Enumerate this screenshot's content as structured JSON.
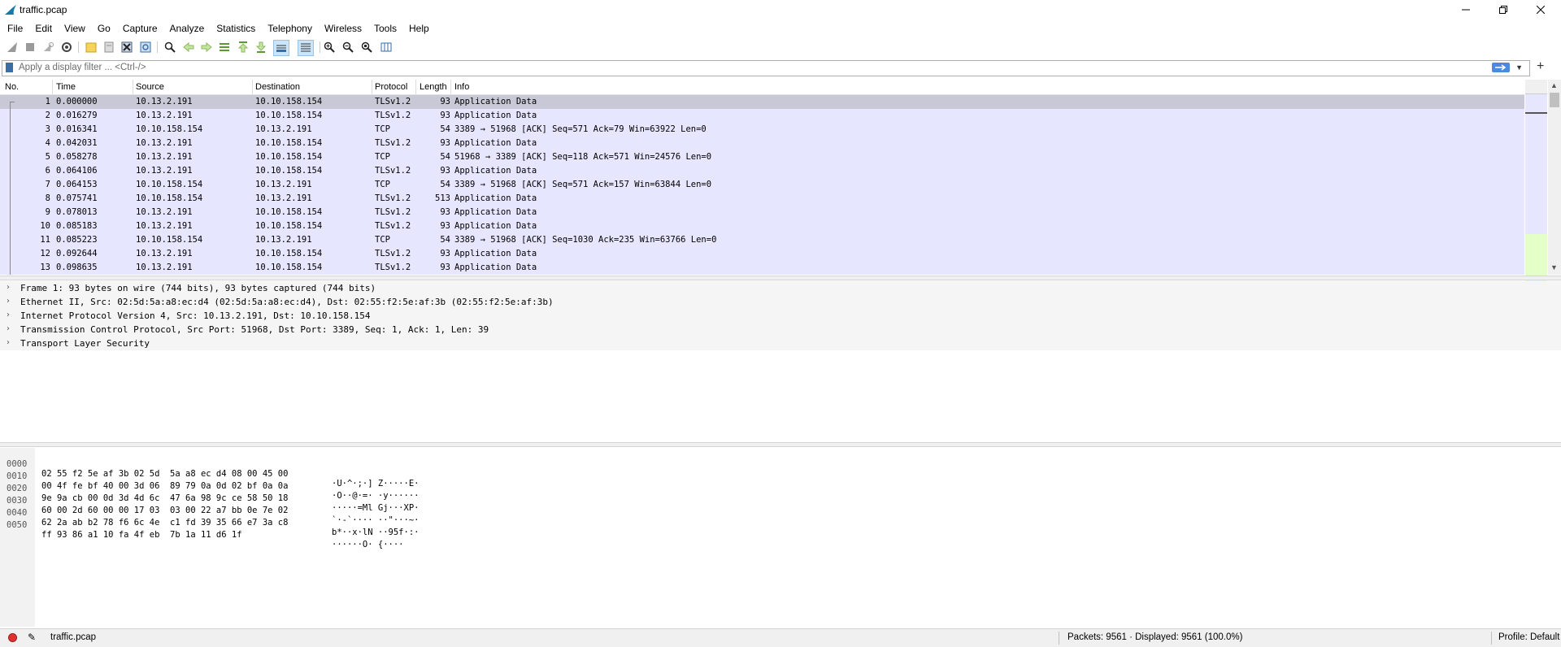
{
  "window": {
    "title": "traffic.pcap"
  },
  "menu": [
    "File",
    "Edit",
    "View",
    "Go",
    "Capture",
    "Analyze",
    "Statistics",
    "Telephony",
    "Wireless",
    "Tools",
    "Help"
  ],
  "filter": {
    "placeholder": "Apply a display filter ... <Ctrl-/>",
    "value": ""
  },
  "columns": {
    "no": "No.",
    "time": "Time",
    "source": "Source",
    "destination": "Destination",
    "protocol": "Protocol",
    "length": "Length",
    "info": "Info"
  },
  "packets": [
    {
      "no": "1",
      "time": "0.000000",
      "src": "10.13.2.191",
      "dst": "10.10.158.154",
      "proto": "TLSv1.2",
      "len": "93",
      "info": "Application Data"
    },
    {
      "no": "2",
      "time": "0.016279",
      "src": "10.13.2.191",
      "dst": "10.10.158.154",
      "proto": "TLSv1.2",
      "len": "93",
      "info": "Application Data"
    },
    {
      "no": "3",
      "time": "0.016341",
      "src": "10.10.158.154",
      "dst": "10.13.2.191",
      "proto": "TCP",
      "len": "54",
      "info": "3389 → 51968 [ACK] Seq=571 Ack=79 Win=63922 Len=0"
    },
    {
      "no": "4",
      "time": "0.042031",
      "src": "10.13.2.191",
      "dst": "10.10.158.154",
      "proto": "TLSv1.2",
      "len": "93",
      "info": "Application Data"
    },
    {
      "no": "5",
      "time": "0.058278",
      "src": "10.13.2.191",
      "dst": "10.10.158.154",
      "proto": "TCP",
      "len": "54",
      "info": "51968 → 3389 [ACK] Seq=118 Ack=571 Win=24576 Len=0"
    },
    {
      "no": "6",
      "time": "0.064106",
      "src": "10.13.2.191",
      "dst": "10.10.158.154",
      "proto": "TLSv1.2",
      "len": "93",
      "info": "Application Data"
    },
    {
      "no": "7",
      "time": "0.064153",
      "src": "10.10.158.154",
      "dst": "10.13.2.191",
      "proto": "TCP",
      "len": "54",
      "info": "3389 → 51968 [ACK] Seq=571 Ack=157 Win=63844 Len=0"
    },
    {
      "no": "8",
      "time": "0.075741",
      "src": "10.10.158.154",
      "dst": "10.13.2.191",
      "proto": "TLSv1.2",
      "len": "513",
      "info": "Application Data"
    },
    {
      "no": "9",
      "time": "0.078013",
      "src": "10.13.2.191",
      "dst": "10.10.158.154",
      "proto": "TLSv1.2",
      "len": "93",
      "info": "Application Data"
    },
    {
      "no": "10",
      "time": "0.085183",
      "src": "10.13.2.191",
      "dst": "10.10.158.154",
      "proto": "TLSv1.2",
      "len": "93",
      "info": "Application Data"
    },
    {
      "no": "11",
      "time": "0.085223",
      "src": "10.10.158.154",
      "dst": "10.13.2.191",
      "proto": "TCP",
      "len": "54",
      "info": "3389 → 51968 [ACK] Seq=1030 Ack=235 Win=63766 Len=0"
    },
    {
      "no": "12",
      "time": "0.092644",
      "src": "10.13.2.191",
      "dst": "10.10.158.154",
      "proto": "TLSv1.2",
      "len": "93",
      "info": "Application Data"
    },
    {
      "no": "13",
      "time": "0.098635",
      "src": "10.13.2.191",
      "dst": "10.10.158.154",
      "proto": "TLSv1.2",
      "len": "93",
      "info": "Application Data"
    }
  ],
  "details": [
    "Frame 1: 93 bytes on wire (744 bits), 93 bytes captured (744 bits)",
    "Ethernet II, Src: 02:5d:5a:a8:ec:d4 (02:5d:5a:a8:ec:d4), Dst: 02:55:f2:5e:af:3b (02:55:f2:5e:af:3b)",
    "Internet Protocol Version 4, Src: 10.13.2.191, Dst: 10.10.158.154",
    "Transmission Control Protocol, Src Port: 51968, Dst Port: 3389, Seq: 1, Ack: 1, Len: 39",
    "Transport Layer Security"
  ],
  "bytes": [
    {
      "offset": "0000",
      "hex": "02 55 f2 5e af 3b 02 5d  5a a8 ec d4 08 00 45 00",
      "ascii": "·U·^·;·] Z·····E·"
    },
    {
      "offset": "0010",
      "hex": "00 4f fe bf 40 00 3d 06  89 79 0a 0d 02 bf 0a 0a",
      "ascii": "·O··@·=· ·y······"
    },
    {
      "offset": "0020",
      "hex": "9e 9a cb 00 0d 3d 4d 6c  47 6a 98 9c ce 58 50 18",
      "ascii": "·····=Ml Gj···XP·"
    },
    {
      "offset": "0030",
      "hex": "60 00 2d 60 00 00 17 03  03 00 22 a7 bb 0e 7e 02",
      "ascii": "`·-`···· ··\"···~·"
    },
    {
      "offset": "0040",
      "hex": "62 2a ab b2 78 f6 6c 4e  c1 fd 39 35 66 e7 3a c8",
      "ascii": "b*··x·lN ··95f·:·"
    },
    {
      "offset": "0050",
      "hex": "ff 93 86 a1 10 fa 4f eb  7b 1a 11 d6 1f",
      "ascii": "······O· {····"
    }
  ],
  "status": {
    "file": "traffic.pcap",
    "packets": "Packets: 9561 · Displayed: 9561 (100.0%)",
    "profile": "Profile: Default"
  },
  "colors": {
    "tls_row": "#e7e6ff",
    "selected_row": "#c9c8d6",
    "minimap_green": "#e4ffc7"
  }
}
